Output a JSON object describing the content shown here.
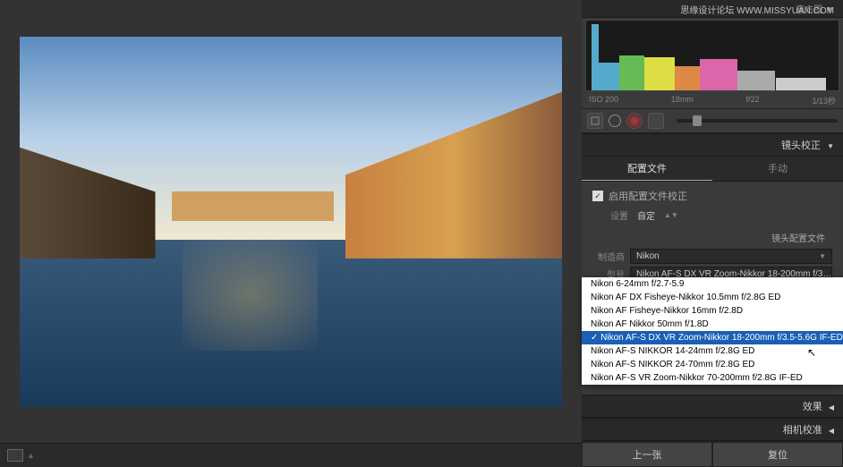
{
  "watermark": "思缘设计论坛   WWW.MISSYUAN.COM",
  "histogram": {
    "title": "直方图",
    "triangle": "▼",
    "info": {
      "iso": "ISO 200",
      "focal": "18mm",
      "aperture": "f/22",
      "shutter": "1/13秒"
    }
  },
  "panels": {
    "lens_correction": {
      "title": "镜头校正",
      "tabs": {
        "profile": "配置文件",
        "manual": "手动"
      },
      "enable_label": "启用配置文件校正",
      "setting_label": "设置",
      "setting_value": "自定",
      "profile_title": "镜头配置文件",
      "maker_label": "制造商",
      "maker_value": "Nikon",
      "model_label": "型号",
      "model_value": "Nikon AF-S DX VR Zoom-Nikkor 18-200mm f/3…"
    },
    "effects": "效果",
    "camera_cal": "相机校准"
  },
  "dropdown_items": [
    "Nikon 6-24mm f/2.7-5.9",
    "Nikon AF DX Fisheye-Nikkor 10.5mm f/2.8G ED",
    "Nikon AF Fisheye-Nikkor 16mm f/2.8D",
    "Nikon AF Nikkor 50mm f/1.8D",
    "Nikon AF-S DX VR Zoom-Nikkor 18-200mm f/3.5-5.6G IF-ED",
    "Nikon AF-S NIKKOR 14-24mm f/2.8G ED",
    "Nikon AF-S NIKKOR 24-70mm f/2.8G ED",
    "Nikon AF-S VR Zoom-Nikkor 70-200mm f/2.8G IF-ED"
  ],
  "dropdown_selected_index": 4,
  "nav": {
    "prev": "上一张",
    "reset": "复位"
  }
}
